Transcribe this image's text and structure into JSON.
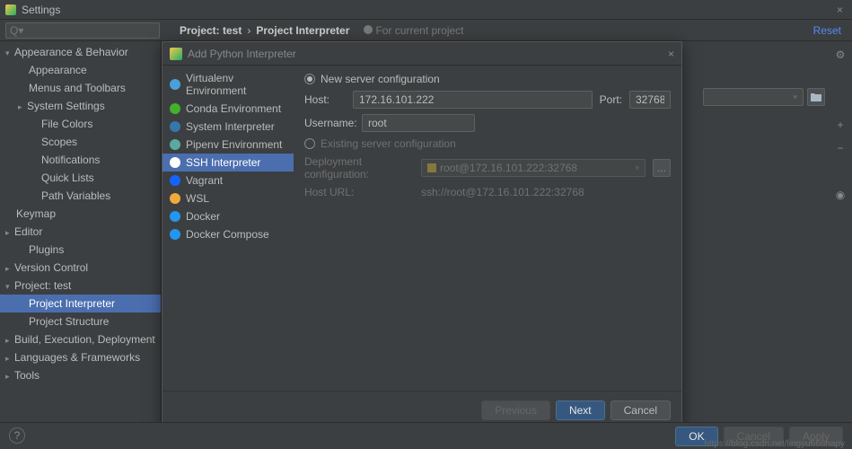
{
  "window": {
    "title": "Settings",
    "close": "×"
  },
  "search": {
    "placeholder": "Q▾"
  },
  "header": {
    "breadcrumb_project": "Project: test",
    "breadcrumb_sep": "›",
    "breadcrumb_page": "Project Interpreter",
    "hint": "For current project",
    "reset": "Reset"
  },
  "sidebar": {
    "items": [
      {
        "label": "Appearance & Behavior",
        "level": 1,
        "caret": "open"
      },
      {
        "label": "Appearance",
        "level": 2
      },
      {
        "label": "Menus and Toolbars",
        "level": 2
      },
      {
        "label": "System Settings",
        "level": 2,
        "caret": "closed"
      },
      {
        "label": "File Colors",
        "level": 3
      },
      {
        "label": "Scopes",
        "level": 3
      },
      {
        "label": "Notifications",
        "level": 3
      },
      {
        "label": "Quick Lists",
        "level": 3
      },
      {
        "label": "Path Variables",
        "level": 3
      },
      {
        "label": "Keymap",
        "level": 1
      },
      {
        "label": "Editor",
        "level": 1,
        "caret": "closed"
      },
      {
        "label": "Plugins",
        "level": 2
      },
      {
        "label": "Version Control",
        "level": 1,
        "caret": "closed"
      },
      {
        "label": "Project: test",
        "level": 1,
        "caret": "open"
      },
      {
        "label": "Project Interpreter",
        "level": 2,
        "selected": true
      },
      {
        "label": "Project Structure",
        "level": 2
      },
      {
        "label": "Build, Execution, Deployment",
        "level": 1,
        "caret": "closed"
      },
      {
        "label": "Languages & Frameworks",
        "level": 1,
        "caret": "closed"
      },
      {
        "label": "Tools",
        "level": 1,
        "caret": "closed"
      }
    ]
  },
  "dialog": {
    "title": "Add Python Interpreter",
    "close": "×",
    "options": [
      {
        "label": "Virtualenv Environment",
        "color": "#4aa0d8"
      },
      {
        "label": "Conda Environment",
        "color": "#43b02a"
      },
      {
        "label": "System Interpreter",
        "color": "#3776ab"
      },
      {
        "label": "Pipenv Environment",
        "color": "#5da9a1"
      },
      {
        "label": "SSH Interpreter",
        "color": "#ffffff",
        "selected": true
      },
      {
        "label": "Vagrant",
        "color": "#1563ff"
      },
      {
        "label": "WSL",
        "color": "#f2a93b"
      },
      {
        "label": "Docker",
        "color": "#2396ed"
      },
      {
        "label": "Docker Compose",
        "color": "#2396ed"
      }
    ],
    "form": {
      "new_label": "New server configuration",
      "host_label": "Host:",
      "host_value": "172.16.101.222",
      "port_label": "Port:",
      "port_value": "32768",
      "user_label": "Username:",
      "user_value": "root",
      "existing_label": "Existing server configuration",
      "deploy_label": "Deployment configuration:",
      "deploy_value": "root@172.16.101.222:32768",
      "dots": "...",
      "url_label": "Host URL:",
      "url_value": "ssh://root@172.16.101.222:32768"
    },
    "buttons": {
      "previous": "Previous",
      "next": "Next",
      "cancel": "Cancel"
    }
  },
  "gutter": {
    "gear": "⚙",
    "plus": "+",
    "minus": "−",
    "eye": "◉"
  },
  "bottom": {
    "ok": "OK",
    "cancel": "Cancel",
    "apply": "Apply",
    "help": "?"
  },
  "watermark": "https://blog.csdn.net/lingyu666hapy"
}
